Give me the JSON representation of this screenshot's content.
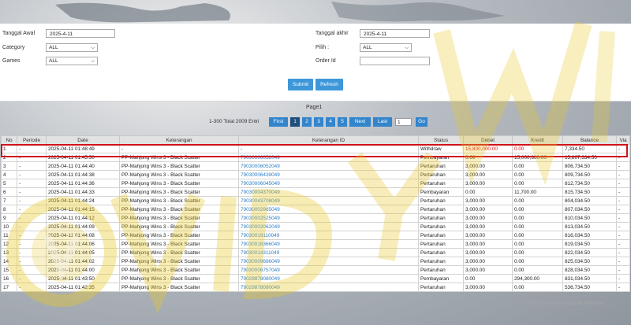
{
  "filters": {
    "tanggal_awal_label": "Tanggal Awal",
    "tanggal_awal_value": "2025-4-11",
    "category_label": "Category",
    "category_value": "ALL",
    "games_label": "Games",
    "games_value": "ALL",
    "tanggal_akhir_label": "Tanggal akhir",
    "tanggal_akhir_value": "2025-4-11",
    "pilih_label": "Pilih :",
    "pilih_value": "ALL",
    "order_id_label": "Order Id",
    "order_id_value": ""
  },
  "buttons": {
    "submit": "Submit",
    "refresh": "Refresh"
  },
  "pager": {
    "title": "Page1",
    "summary": "1-300 Total 2009 Entri",
    "first": "First",
    "pages": [
      "1",
      "2",
      "3",
      "4",
      "5"
    ],
    "next": "Next",
    "last": "Last",
    "page_input": "1",
    "go": "Go"
  },
  "table": {
    "headers": [
      "No",
      "Periode",
      "Date",
      "Keterangan",
      "Keterangan ID",
      "Status",
      "Debet",
      "Kredit",
      "Balance",
      "Via"
    ],
    "rows": [
      [
        "1",
        "-",
        "2025-04-11 01:48:49",
        "-",
        "-",
        "Withdraw",
        "15,800,000.00",
        "0.00",
        "7,334.50",
        "-"
      ],
      [
        "2",
        "-",
        "2025-04-11 01:45:50",
        "PP-Mahjong Wins 3 - Black Scatter",
        "79030006052049",
        "Pembayaran",
        "0.00",
        "15,000,600.00",
        "15,807,334.50",
        "-"
      ],
      [
        "3",
        "-",
        "2025-04-11 01:44:40",
        "PP-Mahjong Wins 3 - Black Scatter",
        "79030006052049",
        "Pertaruhan",
        "3,000.00",
        "0.00",
        "806,734.50",
        "-"
      ],
      [
        "4",
        "-",
        "2025-04-11 01:44:38",
        "PP-Mahjong Wins 3 - Black Scatter",
        "79030006439049",
        "Pertaruhan",
        "3,000.00",
        "0.00",
        "809,734.50",
        "-"
      ],
      [
        "5",
        "-",
        "2025-04-11 01:44:36",
        "PP-Mahjong Wins 3 - Black Scatter",
        "79030006045049",
        "Pertaruhan",
        "3,000.00",
        "0.00",
        "812,734.50",
        "-"
      ],
      [
        "6",
        "-",
        "2025-04-11 01:44:33",
        "PP-Mahjong Wins 3 - Black Scatter",
        "79030004370049",
        "Pembayaran",
        "0.00",
        "11,700.00",
        "815,734.50",
        "-"
      ],
      [
        "7",
        "-",
        "2025-04-11 01:44:24",
        "PP-Mahjong Wins 3 - Black Scatter",
        "79030043708049",
        "Pertaruhan",
        "3,000.00",
        "0.00",
        "804,034.50",
        "-"
      ],
      [
        "8",
        "-",
        "2025-04-11 01:44:15",
        "PP-Mahjong Wins 3 - Black Scatter",
        "79030002965049",
        "Pertaruhan",
        "3,000.00",
        "0.00",
        "807,034.50",
        "-"
      ],
      [
        "9",
        "-",
        "2025-04-11 01:44:12",
        "PP-Mahjong Wins 3 - Black Scatter",
        "79030002525049",
        "Pertaruhan",
        "3,000.00",
        "0.00",
        "810,034.50",
        "-"
      ],
      [
        "10",
        "-",
        "2025-04-11 01:44:09",
        "PP-Mahjong Wins 3 - Black Scatter",
        "79030002062049",
        "Pertaruhan",
        "3,000.00",
        "0.00",
        "813,034.50",
        "-"
      ],
      [
        "11",
        "-",
        "2025-04-11 01:44:08",
        "PP-Mahjong Wins 3 - Black Scatter",
        "79030019110049",
        "Pertaruhan",
        "3,000.00",
        "0.00",
        "816,034.50",
        "-"
      ],
      [
        "12",
        "-",
        "2025-04-11 01:44:06",
        "PP-Mahjong Wins 3 - Black Scatter",
        "79030016366049",
        "Pertaruhan",
        "3,000.00",
        "0.00",
        "819,034.50",
        "-"
      ],
      [
        "13",
        "-",
        "2025-04-11 01:44:05",
        "PP-Mahjong Wins 3 - Black Scatter",
        "79030014311049",
        "Pertaruhan",
        "3,000.00",
        "0.00",
        "822,034.50",
        "-"
      ],
      [
        "14",
        "-",
        "2025-04-11 01:44:02",
        "PP-Mahjong Wins 3 - Black Scatter",
        "79030009686049",
        "Pertaruhan",
        "3,000.00",
        "0.00",
        "825,034.50",
        "-"
      ],
      [
        "15",
        "-",
        "2025-04-11 01:44:00",
        "PP-Mahjong Wins 3 - Black Scatter",
        "79030006757049",
        "Pertaruhan",
        "3,000.00",
        "0.00",
        "828,034.50",
        "-"
      ],
      [
        "16",
        "-",
        "2025-04-11 01:43:50",
        "PP-Mahjong Wins 3 - Black Scatter",
        "79029878080049",
        "Pembayaran",
        "0.00",
        "294,300.00",
        "831,034.50",
        "-"
      ],
      [
        "17",
        "-",
        "2025-04-11 01:42:35",
        "PP-Mahjong Wins 3 - Black Scatter",
        "79029878080049",
        "Pertaruhan",
        "3,000.00",
        "0.00",
        "536,734.50",
        "-"
      ]
    ]
  },
  "watermark": {
    "text": "VIDYWIK"
  },
  "activate": {
    "title": "Activate Windows",
    "subtitle": "Go to Settings to activate Windows."
  },
  "colors": {
    "accent": "#3d97d9",
    "highlight": "#d0121b",
    "link": "#2b7dc8",
    "debit_red": "#dd1111"
  }
}
